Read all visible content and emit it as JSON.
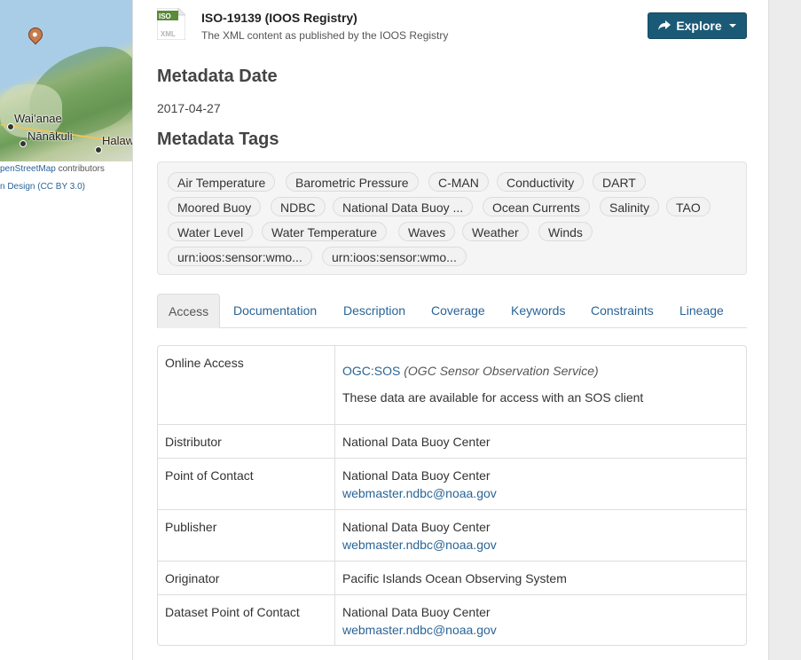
{
  "map": {
    "places": [
      "Waiʻanae",
      "Nānākuli",
      "Halaw"
    ],
    "attribution_line1_link": "penStreetMap",
    "attribution_line1_rest": " contributors",
    "attribution_line2": "n Design (CC BY 3.0)"
  },
  "resource": {
    "icon_top": "ISO",
    "icon_bottom": "XML",
    "title": "ISO-19139 (IOOS Registry)",
    "description": "The XML content as published by the IOOS Registry",
    "explore_label": "Explore"
  },
  "metadata_date": {
    "heading": "Metadata Date",
    "value": "2017-04-27"
  },
  "metadata_tags": {
    "heading": "Metadata Tags",
    "tags": [
      "Air Temperature",
      "Barometric Pressure",
      "C-MAN",
      "Conductivity",
      "DART",
      "Moored Buoy",
      "NDBC",
      "National Data Buoy ...",
      "Ocean Currents",
      "Salinity",
      "TAO",
      "Water Level",
      "Water Temperature",
      "Waves",
      "Weather",
      "Winds",
      "urn:ioos:sensor:wmo...",
      "urn:ioos:sensor:wmo..."
    ]
  },
  "tabs": [
    "Access",
    "Documentation",
    "Description",
    "Coverage",
    "Keywords",
    "Constraints",
    "Lineage"
  ],
  "access": {
    "online_access_label": "Online Access",
    "ogc_link": "OGC:SOS",
    "ogc_desc": "(OGC Sensor Observation Service)",
    "ogc_note": "These data are available for access with an SOS client",
    "rows": [
      {
        "label": "Distributor",
        "name": "National Data Buoy Center",
        "email": ""
      },
      {
        "label": "Point of Contact",
        "name": "National Data Buoy Center",
        "email": "webmaster.ndbc@noaa.gov"
      },
      {
        "label": "Publisher",
        "name": "National Data Buoy Center",
        "email": "webmaster.ndbc@noaa.gov"
      },
      {
        "label": "Originator",
        "name": "Pacific Islands Ocean Observing System",
        "email": ""
      },
      {
        "label": "Dataset Point of Contact",
        "name": "National Data Buoy Center",
        "email": "webmaster.ndbc@noaa.gov"
      }
    ]
  },
  "colors": {
    "accent": "#2a6496",
    "explore_bg": "#1b5a77"
  }
}
